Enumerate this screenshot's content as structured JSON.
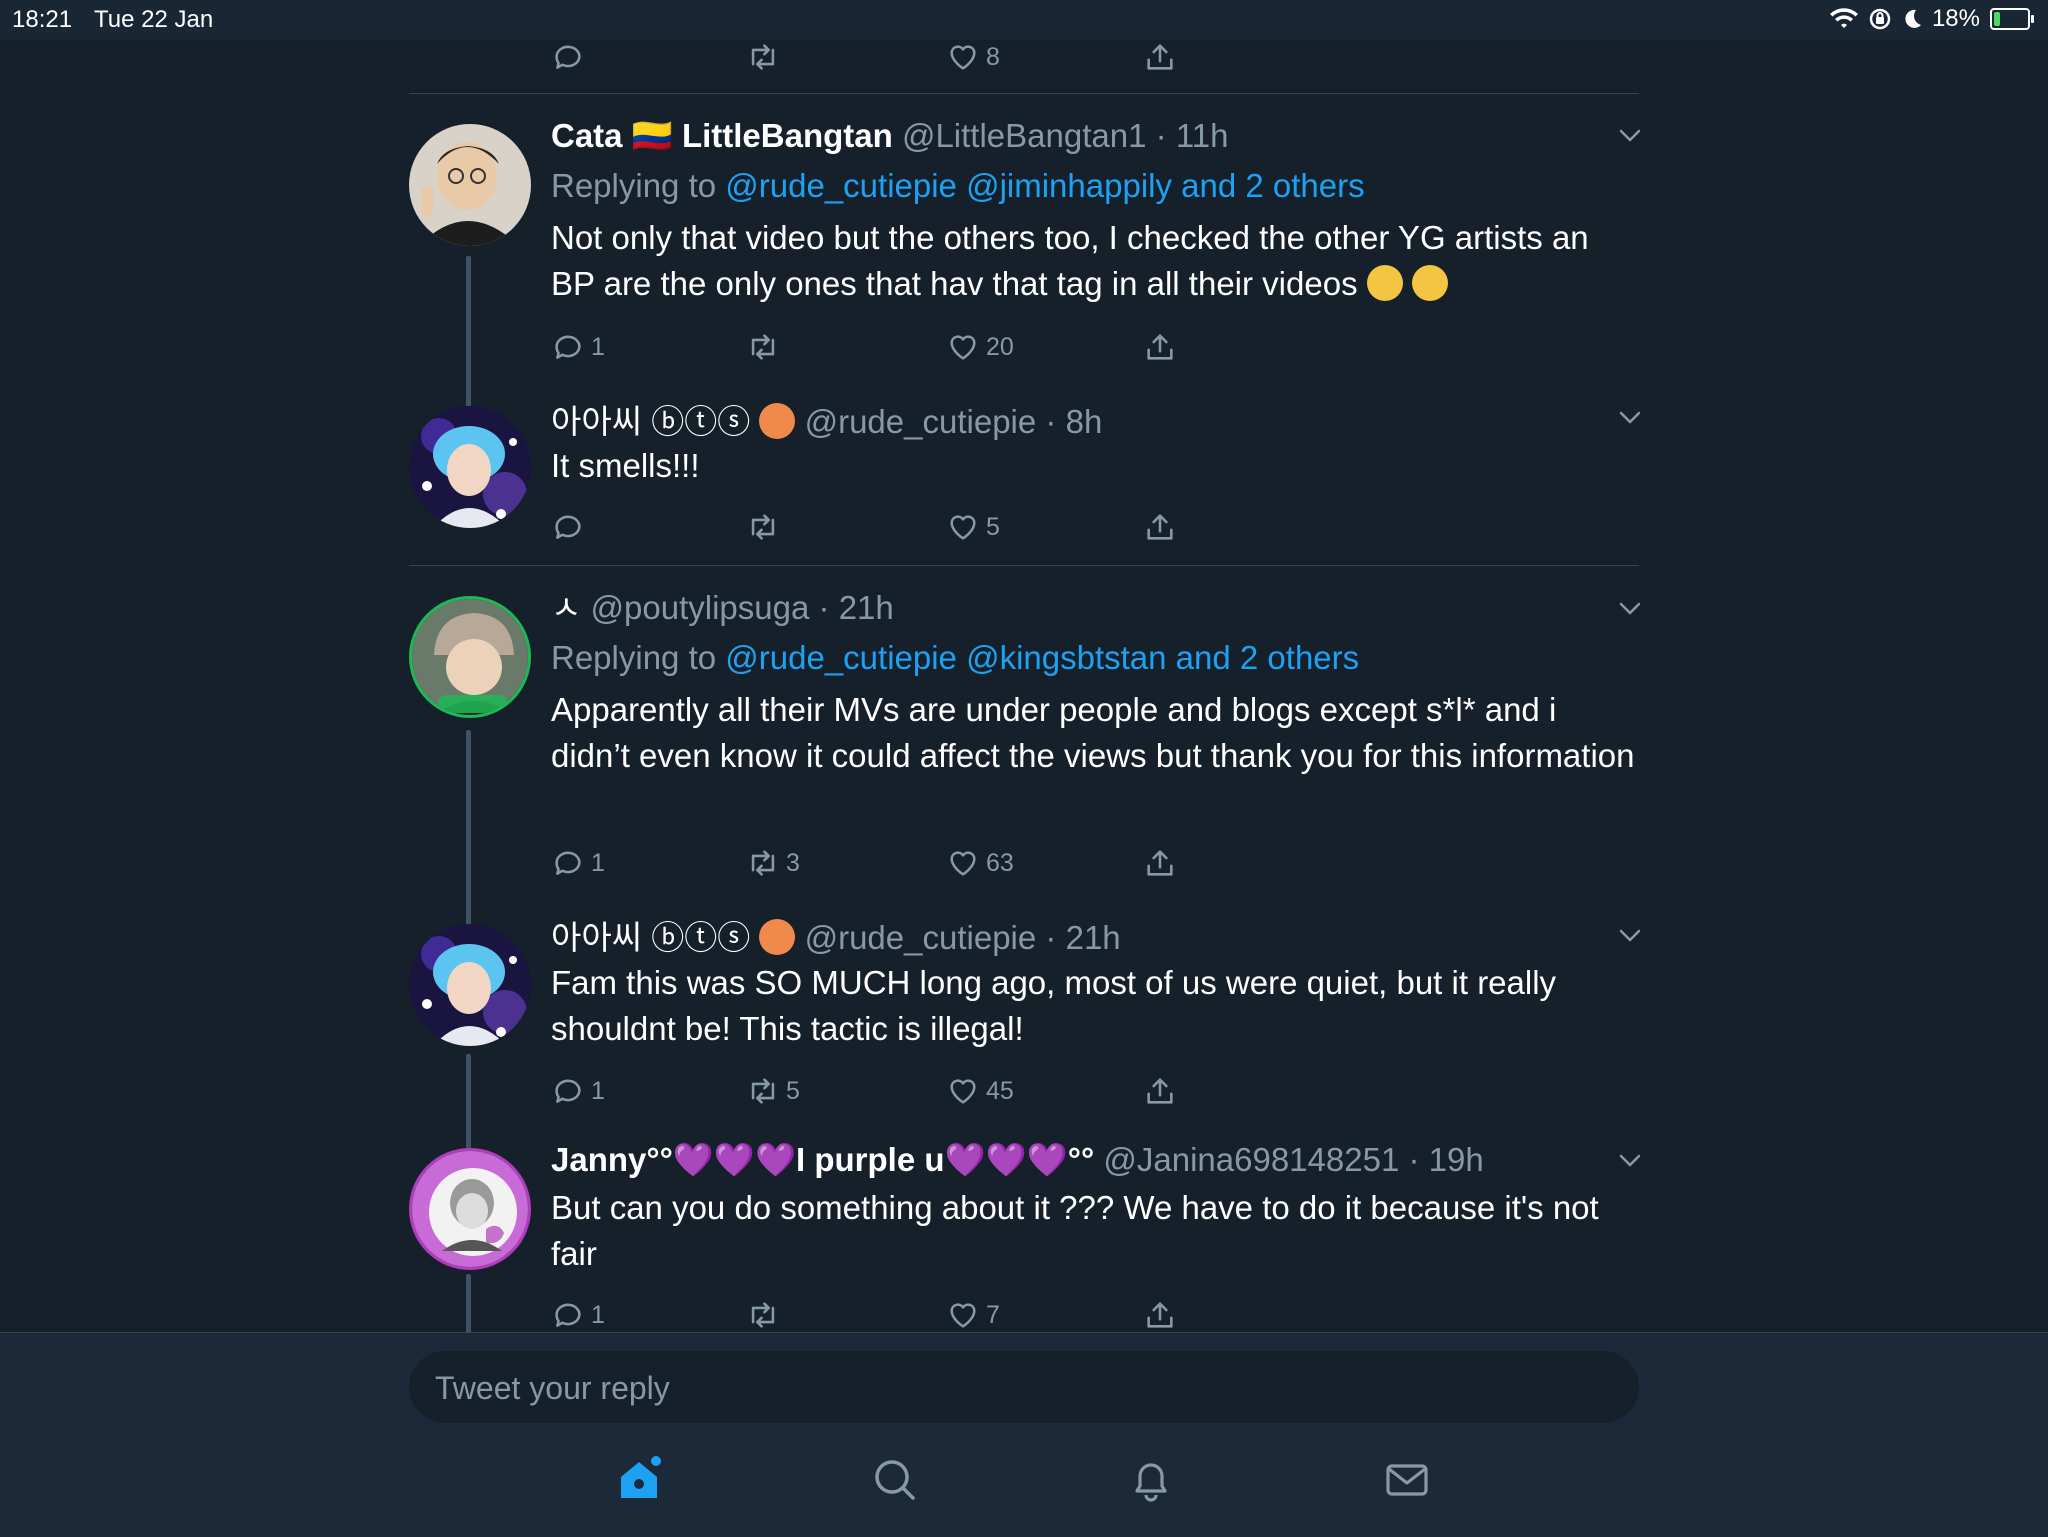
{
  "status_bar": {
    "time": "18:21",
    "date": "Tue 22 Jan",
    "battery": "18%",
    "battery_level": 0.18
  },
  "top_actions": {
    "like_count": "8"
  },
  "tweets": [
    {
      "name": "Cata 🇨🇴 LittleBangtan",
      "handle": "@LittleBangtan1",
      "time": "11h",
      "replying_prefix": "Replying to ",
      "replying_to": "@rude_cutiepie @jiminhappily and 2 others",
      "text": "Not only that video but the others too, I checked the other YG artists an BP are the only ones that hav that tag in all their videos",
      "replies": "1",
      "retweets": "",
      "likes": "20"
    },
    {
      "name": "아아씨 ⓑⓣⓢ",
      "handle": "@rude_cutiepie",
      "time": "8h",
      "text": "It smells!!!",
      "replies": "",
      "retweets": "",
      "likes": "5"
    },
    {
      "name": "ㅅ",
      "handle": "@poutylipsuga",
      "time": "21h",
      "replying_prefix": "Replying to ",
      "replying_to": "@rude_cutiepie @kingsbtstan and 2 others",
      "text": "Apparently all their MVs are under people and blogs except s*l* and i didn’t even know it could affect the views but thank you for this information",
      "replies": "1",
      "retweets": "3",
      "likes": "63"
    },
    {
      "name": "아아씨 ⓑⓣⓢ",
      "handle": "@rude_cutiepie",
      "time": "21h",
      "text": "Fam this was SO MUCH long ago, most of us were quiet, but it really shouldnt be! This tactic is illegal!",
      "replies": "1",
      "retweets": "5",
      "likes": "45"
    },
    {
      "name": "Janny°°💜💜💜I purple u💜💜💜°°",
      "handle": "@Janina698148251",
      "time": "19h",
      "text": "But can you do something about it ??? We have to do it because it's not fair",
      "replies": "1",
      "retweets": "",
      "likes": "7"
    }
  ],
  "composer": {
    "placeholder": "Tweet your reply"
  },
  "colors": {
    "background": "#15202b",
    "accent": "#1da1f2",
    "muted": "#8899a6",
    "divider": "#38444d"
  },
  "nav_icons": [
    "home-icon",
    "search-icon",
    "notifications-icon",
    "messages-icon"
  ]
}
